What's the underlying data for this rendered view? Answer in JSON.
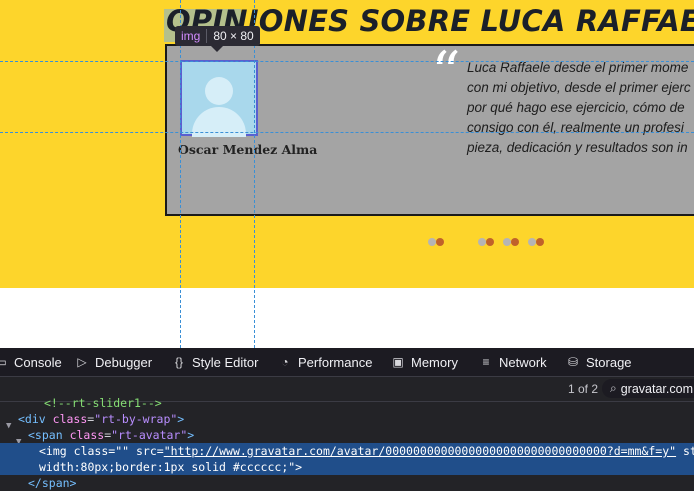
{
  "page": {
    "title": "OPINIONES SOBRE LUCA RAFFAELE",
    "quote_mark": "“",
    "testimonial_lines": [
      "Luca Raffaele desde el primer mome",
      "con mi objetivo, desde el primer ejerc",
      "por qué hago ese ejercicio, cómo de",
      "consigo con él, realmente un profesi",
      "pieza, dedicación y resultados son in"
    ],
    "author": "Oscar Mendez Alma",
    "colors": {
      "background": "#fdd52b",
      "card": "#a4a4a4",
      "dot_active": "#c0622a",
      "dot_inactive": "#b5b5b5"
    }
  },
  "inspector_tooltip": {
    "tag": "img",
    "dimensions": "80 × 80"
  },
  "devtools": {
    "tabs": [
      {
        "label": "Console",
        "icon": "console-icon"
      },
      {
        "label": "Debugger",
        "icon": "debugger-icon"
      },
      {
        "label": "Style Editor",
        "icon": "style-editor-icon"
      },
      {
        "label": "Performance",
        "icon": "performance-icon"
      },
      {
        "label": "Memory",
        "icon": "memory-icon"
      },
      {
        "label": "Network",
        "icon": "network-icon"
      },
      {
        "label": "Storage",
        "icon": "storage-icon"
      }
    ],
    "search": {
      "match_count": "1 of 2",
      "value": "gravatar.com"
    },
    "markup": {
      "comment": "<!--rt-slider1-->",
      "div_open": "<div",
      "div_attr_name": "class",
      "div_attr_value": "\"rt-by-wrap\"",
      "div_close": ">",
      "span_open": "<span",
      "span_attr_name": "class",
      "span_attr_value": "\"rt-avatar\"",
      "span_close": ">",
      "img_open": "<img",
      "img_class_name": "class",
      "img_class_value": "\"\"",
      "img_src_name": "src",
      "img_src_value": "\"http://www.gravatar.com/avatar/00000000000000000000000000000000?d=mm&f=y\"",
      "img_style_name": "style",
      "img_style_cont": "width:80px;border:1px solid #cccccc;\">",
      "span_end": "</span>"
    }
  }
}
